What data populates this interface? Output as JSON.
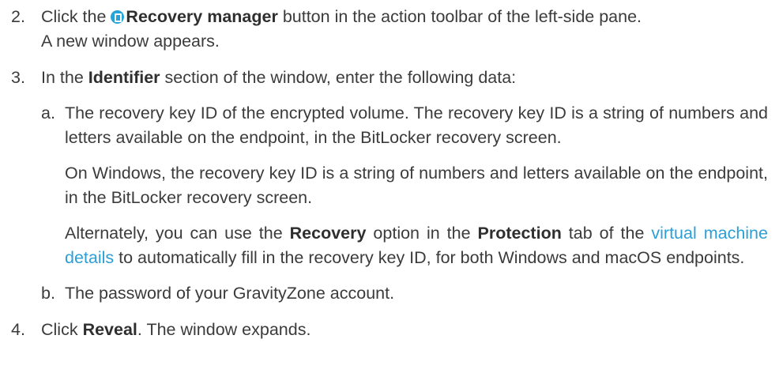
{
  "steps": [
    {
      "num": "2.",
      "prefix": "Click the ",
      "icon": "recovery-manager-icon",
      "bold": "Recovery manager",
      "suffix": " button in the action toolbar of the left-side pane.",
      "line2": "A new window appears."
    },
    {
      "num": "3.",
      "prefix": "In the ",
      "bold": "Identifier",
      "suffix": " section of the window, enter the following data:",
      "substeps": [
        {
          "num": "a.",
          "text": "The recovery key ID of the encrypted volume. The recovery key ID is a string of numbers and letters available on the endpoint, in the BitLocker recovery screen.",
          "para2": "On Windows, the recovery key ID is a string of numbers and letters available on the endpoint, in the BitLocker recovery screen.",
          "para3": {
            "t1": "Alternately, you can use the ",
            "b1": "Recovery",
            "t2": " option in the ",
            "b2": "Protection",
            "t3": " tab of the ",
            "link": "virtual machine details",
            "t4": " to automatically fill in the recovery key ID, for both Windows and macOS endpoints."
          }
        },
        {
          "num": "b.",
          "text": "The password of your GravityZone account."
        }
      ]
    },
    {
      "num": "4.",
      "prefix": "Click ",
      "bold": "Reveal",
      "suffix": ". The window expands."
    }
  ],
  "colors": {
    "text": "#3b3b3b",
    "link": "#2b9fd6",
    "icon": "#27a3d8"
  }
}
